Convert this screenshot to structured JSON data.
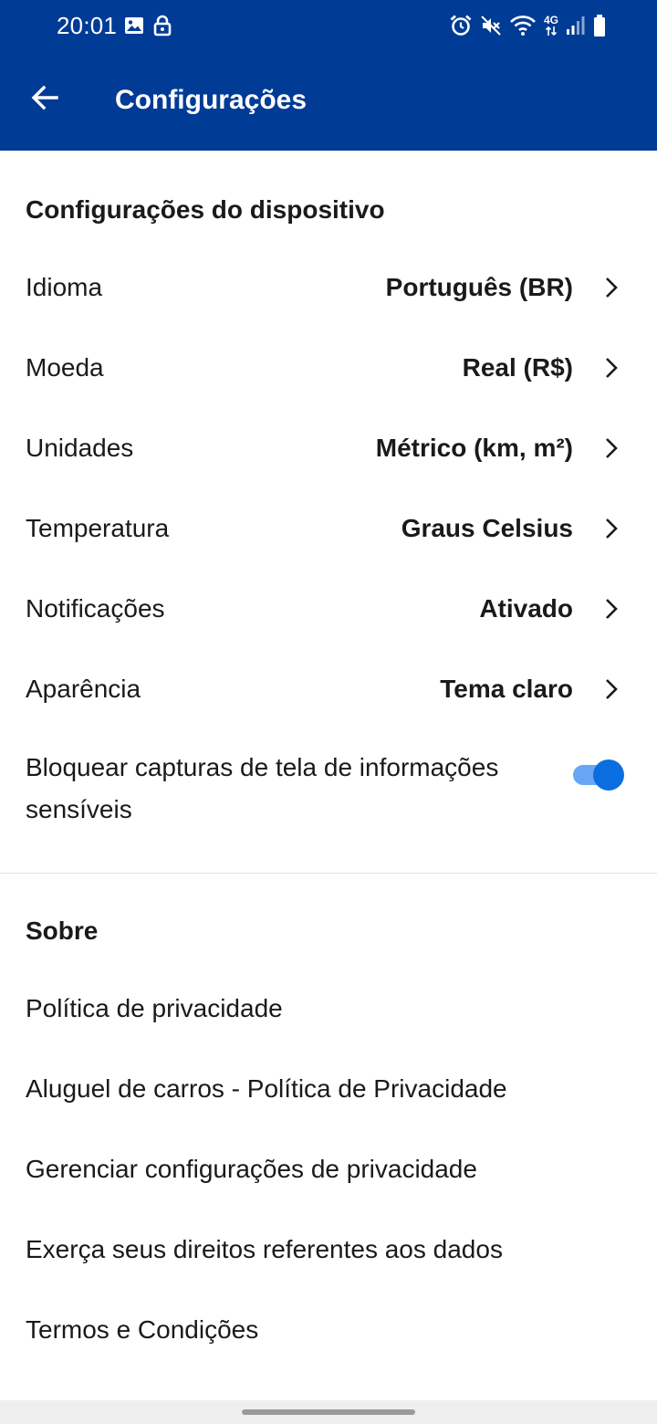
{
  "status_bar": {
    "time": "20:01",
    "network_type": "4G",
    "icons": [
      "image-icon",
      "lock-icon",
      "alarm-icon",
      "mute-icon",
      "wifi-icon",
      "signal-icon",
      "battery-icon"
    ]
  },
  "toolbar": {
    "back_icon": "arrow-left-icon",
    "title": "Configurações"
  },
  "colors": {
    "app_bar": "#003b95",
    "toggle_thumb": "#0a6ee0",
    "toggle_track": "#68a6f5"
  },
  "device_settings": {
    "header": "Configurações do dispositivo",
    "rows": [
      {
        "label": "Idioma",
        "value": "Português (BR)"
      },
      {
        "label": "Moeda",
        "value": "Real (R$)"
      },
      {
        "label": "Unidades",
        "value": "Métrico (km, m²)"
      },
      {
        "label": "Temperatura",
        "value": "Graus Celsius"
      },
      {
        "label": "Notificações",
        "value": "Ativado"
      },
      {
        "label": "Aparência",
        "value": "Tema claro"
      }
    ],
    "screenshot_toggle": {
      "label": "Bloquear capturas de tela de informações sensíveis",
      "enabled": true
    }
  },
  "about": {
    "header": "Sobre",
    "links": [
      "Política de privacidade",
      "Aluguel de carros - Política de Privacidade",
      "Gerenciar configurações de privacidade",
      "Exerça seus direitos referentes aos dados",
      "Termos e Condições"
    ]
  }
}
